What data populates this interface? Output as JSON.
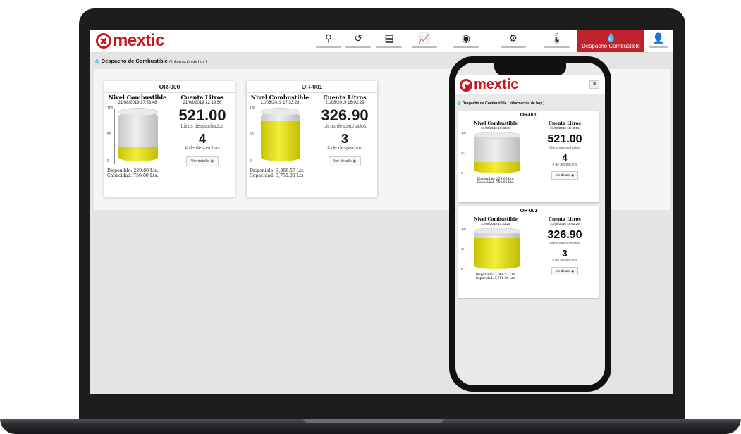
{
  "brand": {
    "logo_text": "mextic"
  },
  "nav": {
    "items": [
      {
        "icon": "map-pin-icon",
        "glyph": "⚲"
      },
      {
        "icon": "history-icon",
        "glyph": "↺"
      },
      {
        "icon": "document-icon",
        "glyph": "▤"
      },
      {
        "icon": "chart-line-icon",
        "glyph": "📈"
      },
      {
        "icon": "eye-icon",
        "glyph": "◉"
      },
      {
        "icon": "gear-icon",
        "glyph": "⚙"
      },
      {
        "icon": "thermometer-icon",
        "glyph": "🌡"
      }
    ],
    "active_label": "Despacho Combustible",
    "user_icon": "user-icon"
  },
  "breadcrumb": {
    "title": "Despacho de Combustible",
    "note": "( Información de hoy )"
  },
  "cards": [
    {
      "code": "OR-000",
      "level_title": "Nivel Combustible",
      "level_date": "21/08/2019 17:33:48",
      "axis": [
        "100",
        "50",
        "0"
      ],
      "fill_pct": 0.305,
      "available": "Disponible: 229.00 Lts.",
      "capacity": "Capacidad: 750.00 Lts.",
      "counter_title": "Cuenta Litros",
      "counter_date": "21/08/2019 12:19:56",
      "liters": "521.00",
      "liters_label": "Litros despachados",
      "dispatches": "4",
      "dispatches_label": "# de despachos",
      "detail_button": "Ver detalle ◉"
    },
    {
      "code": "OR-001",
      "level_title": "Nivel Combustible",
      "level_date": "21/08/2019 17:33:28",
      "axis": [
        "100",
        "50",
        "0"
      ],
      "fill_pct": 0.818,
      "available": "Disponible: 3,066.57 Lts",
      "capacity": "Capacidad: 3,750.00 Lts",
      "counter_title": "Cuenta Litros",
      "counter_date": "21/08/2019 16:02:29",
      "liters": "326.90",
      "liters_label": "Litros despachados",
      "dispatches": "3",
      "dispatches_label": "# de despachos",
      "detail_button": "Ver detalle ◉"
    }
  ],
  "phone": {
    "breadcrumb": "Despacho de Combustible ( Información de hoy )",
    "menu_glyph": "≡",
    "cards": [
      {
        "code": "OR-000",
        "level_title": "Nivel Combustible",
        "level_date": "21/08/2019 17:33:48",
        "available": "Disponible: 229.00 Lts.",
        "capacity": "Capacidad: 750.00 Lts.",
        "counter_title": "Cuenta Litros",
        "counter_date": "21/08/2019 12:19:56",
        "liters": "521.00",
        "liters_label": "Litros despachados",
        "dispatches": "4",
        "dispatches_label": "# de despachos",
        "detail_button": "Ver detalle ◉"
      },
      {
        "code": "OR-001",
        "level_title": "Nivel Combustible",
        "level_date": "21/08/2019 17:33:28",
        "available": "Disponible: 3,066.57 Lts.",
        "capacity": "Capacidad: 3,750.00 Lts.",
        "counter_title": "Cuenta Litros",
        "counter_date": "21/08/2019 16:02:29",
        "liters": "326.90",
        "liters_label": "Litros despachados",
        "dispatches": "3",
        "dispatches_label": "# de despachos",
        "detail_button": "Ver detalle ◉"
      }
    ]
  },
  "colors": {
    "brand": "#c8161d",
    "active_nav": "#c0232b",
    "fuel": "#e8e43a"
  }
}
